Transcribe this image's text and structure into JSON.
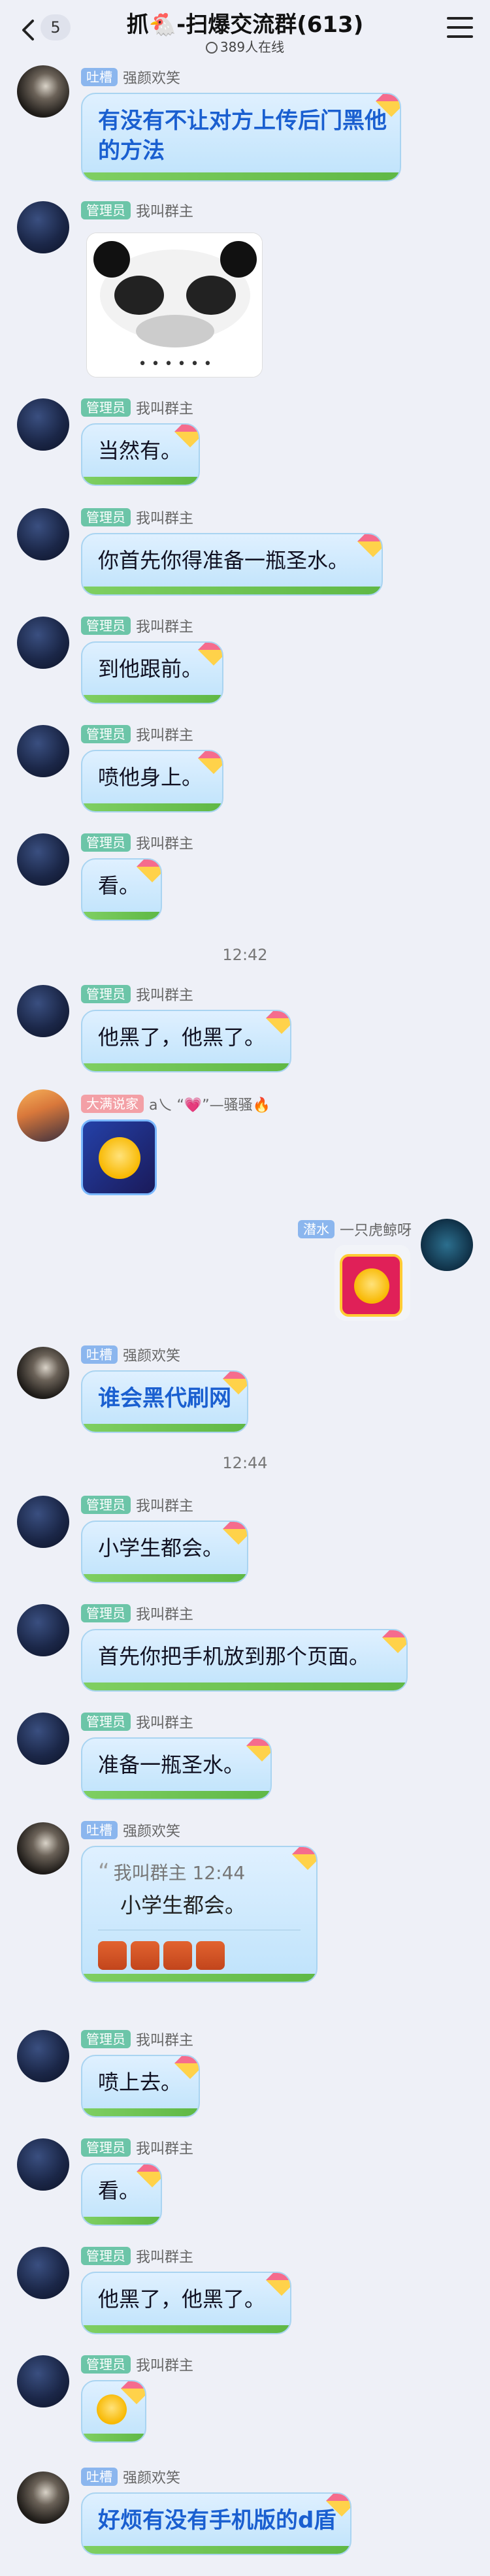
{
  "header": {
    "unread_count": "5",
    "title": "抓🐔-扫爆交流群(613)",
    "online": "389人在线"
  },
  "colors": {
    "bubble": "#bfe3fb",
    "badge_admin": "#6cc5a8",
    "badge_tucao": "#8bb6ee",
    "badge_host": "#f3a0a6"
  },
  "messages": [
    {
      "badge": "吐槽",
      "name": "强颜欢笑",
      "lines": [
        "有没有不让对方上传后门黑他",
        "的方法"
      ]
    },
    {
      "badge": "管理员",
      "name": "我叫群主",
      "sticker": "panda-meme",
      "sticker_caption": "• • • • • •"
    },
    {
      "badge": "管理员",
      "name": "我叫群主",
      "text": "当然有。"
    },
    {
      "badge": "管理员",
      "name": "我叫群主",
      "text": "你首先你得准备一瓶圣水。"
    },
    {
      "badge": "管理员",
      "name": "我叫群主",
      "text": "到他跟前。"
    },
    {
      "badge": "管理员",
      "name": "我叫群主",
      "text": "喷他身上。"
    },
    {
      "badge": "管理员",
      "name": "我叫群主",
      "text": "看。"
    },
    {
      "badge": "管理员",
      "name": "我叫群主",
      "text": "他黑了，他黑了。"
    },
    {
      "badge": "大满说家",
      "name": "a乀 “💗”—骚骚🔥",
      "sticker": "laughing-emoji"
    },
    {
      "badge": "潜水",
      "name": "一只虎鲸呀",
      "sticker": "laughing-emoji"
    },
    {
      "badge": "吐槽",
      "name": "强颜欢笑",
      "text": "谁会黑代刷网"
    },
    {
      "badge": "管理员",
      "name": "我叫群主",
      "text": "小学生都会。"
    },
    {
      "badge": "管理员",
      "name": "我叫群主",
      "text": "首先你把手机放到那个页面。"
    },
    {
      "badge": "管理员",
      "name": "我叫群主",
      "text": "准备一瓶圣水。"
    },
    {
      "badge": "吐槽",
      "name": "强颜欢笑",
      "quote_name": "我叫群主 12:44",
      "quote_text": "小学生都会。",
      "reaction": "hammer-emoji"
    },
    {
      "badge": "管理员",
      "name": "我叫群主",
      "text": "喷上去。"
    },
    {
      "badge": "管理员",
      "name": "我叫群主",
      "text": "看。"
    },
    {
      "badge": "管理员",
      "name": "我叫群主",
      "text": "他黑了，他黑了。"
    },
    {
      "badge": "管理员",
      "name": "我叫群主",
      "sticker": "laughing-emoji"
    },
    {
      "badge": "吐槽",
      "name": "强颜欢笑",
      "text": "好烦有没有手机版的d盾"
    }
  ],
  "times": [
    "12:42",
    "12:44"
  ]
}
